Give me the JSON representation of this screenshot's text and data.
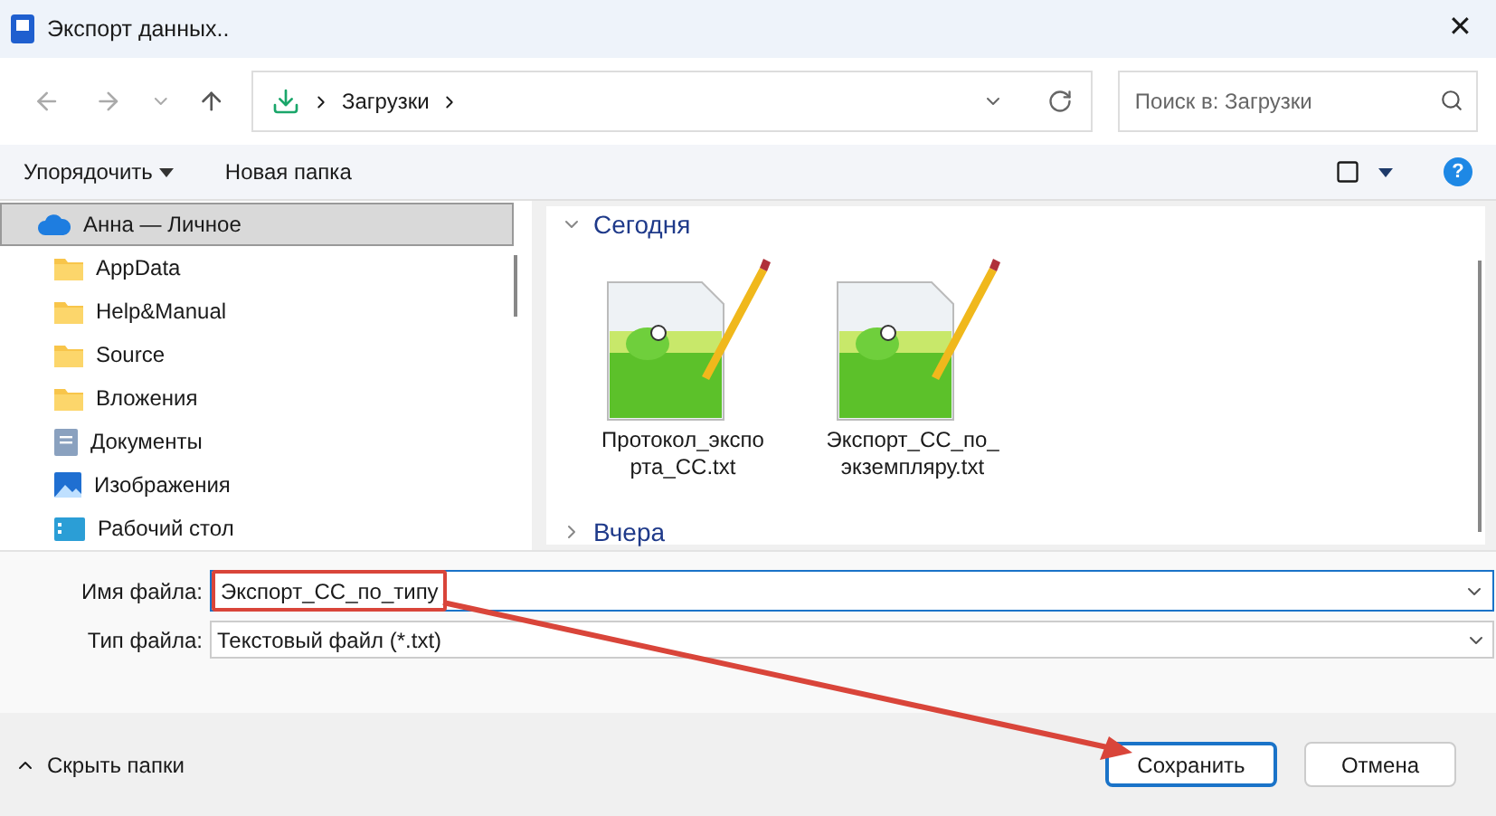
{
  "window": {
    "title": "Экспорт данных..",
    "close": "✕"
  },
  "nav": {
    "path": "Загрузки",
    "search_placeholder": "Поиск в: Загрузки"
  },
  "toolbar": {
    "organize": "Упорядочить",
    "new_folder": "Новая папка",
    "help": "?"
  },
  "sidebar": {
    "items": [
      {
        "label": "Анна — Личное",
        "kind": "cloud",
        "selected": true
      },
      {
        "label": "AppData",
        "kind": "folder",
        "selected": false
      },
      {
        "label": "Help&Manual",
        "kind": "folder",
        "selected": false
      },
      {
        "label": "Source",
        "kind": "folder",
        "selected": false
      },
      {
        "label": "Вложения",
        "kind": "folder",
        "selected": false
      },
      {
        "label": "Документы",
        "kind": "documents",
        "selected": false
      },
      {
        "label": "Изображения",
        "kind": "pictures",
        "selected": false
      },
      {
        "label": "Рабочий стол",
        "kind": "desktop",
        "selected": false
      }
    ]
  },
  "groups": [
    {
      "title": "Сегодня",
      "expanded": true,
      "files": [
        {
          "name": "Протокол_экспо\nрта_CC.txt"
        },
        {
          "name": "Экспорт_CC_по_\nэкземпляру.txt"
        }
      ]
    },
    {
      "title": "Вчера",
      "expanded": false
    }
  ],
  "form": {
    "file_name_label": "Имя файла:",
    "file_name": "Экспорт_CC_по_типу",
    "file_type_label": "Тип файла:",
    "file_type": "Текстовый файл (*.txt)"
  },
  "footer": {
    "hide_folders": "Скрыть папки",
    "save": "Сохранить",
    "cancel": "Отмена"
  }
}
